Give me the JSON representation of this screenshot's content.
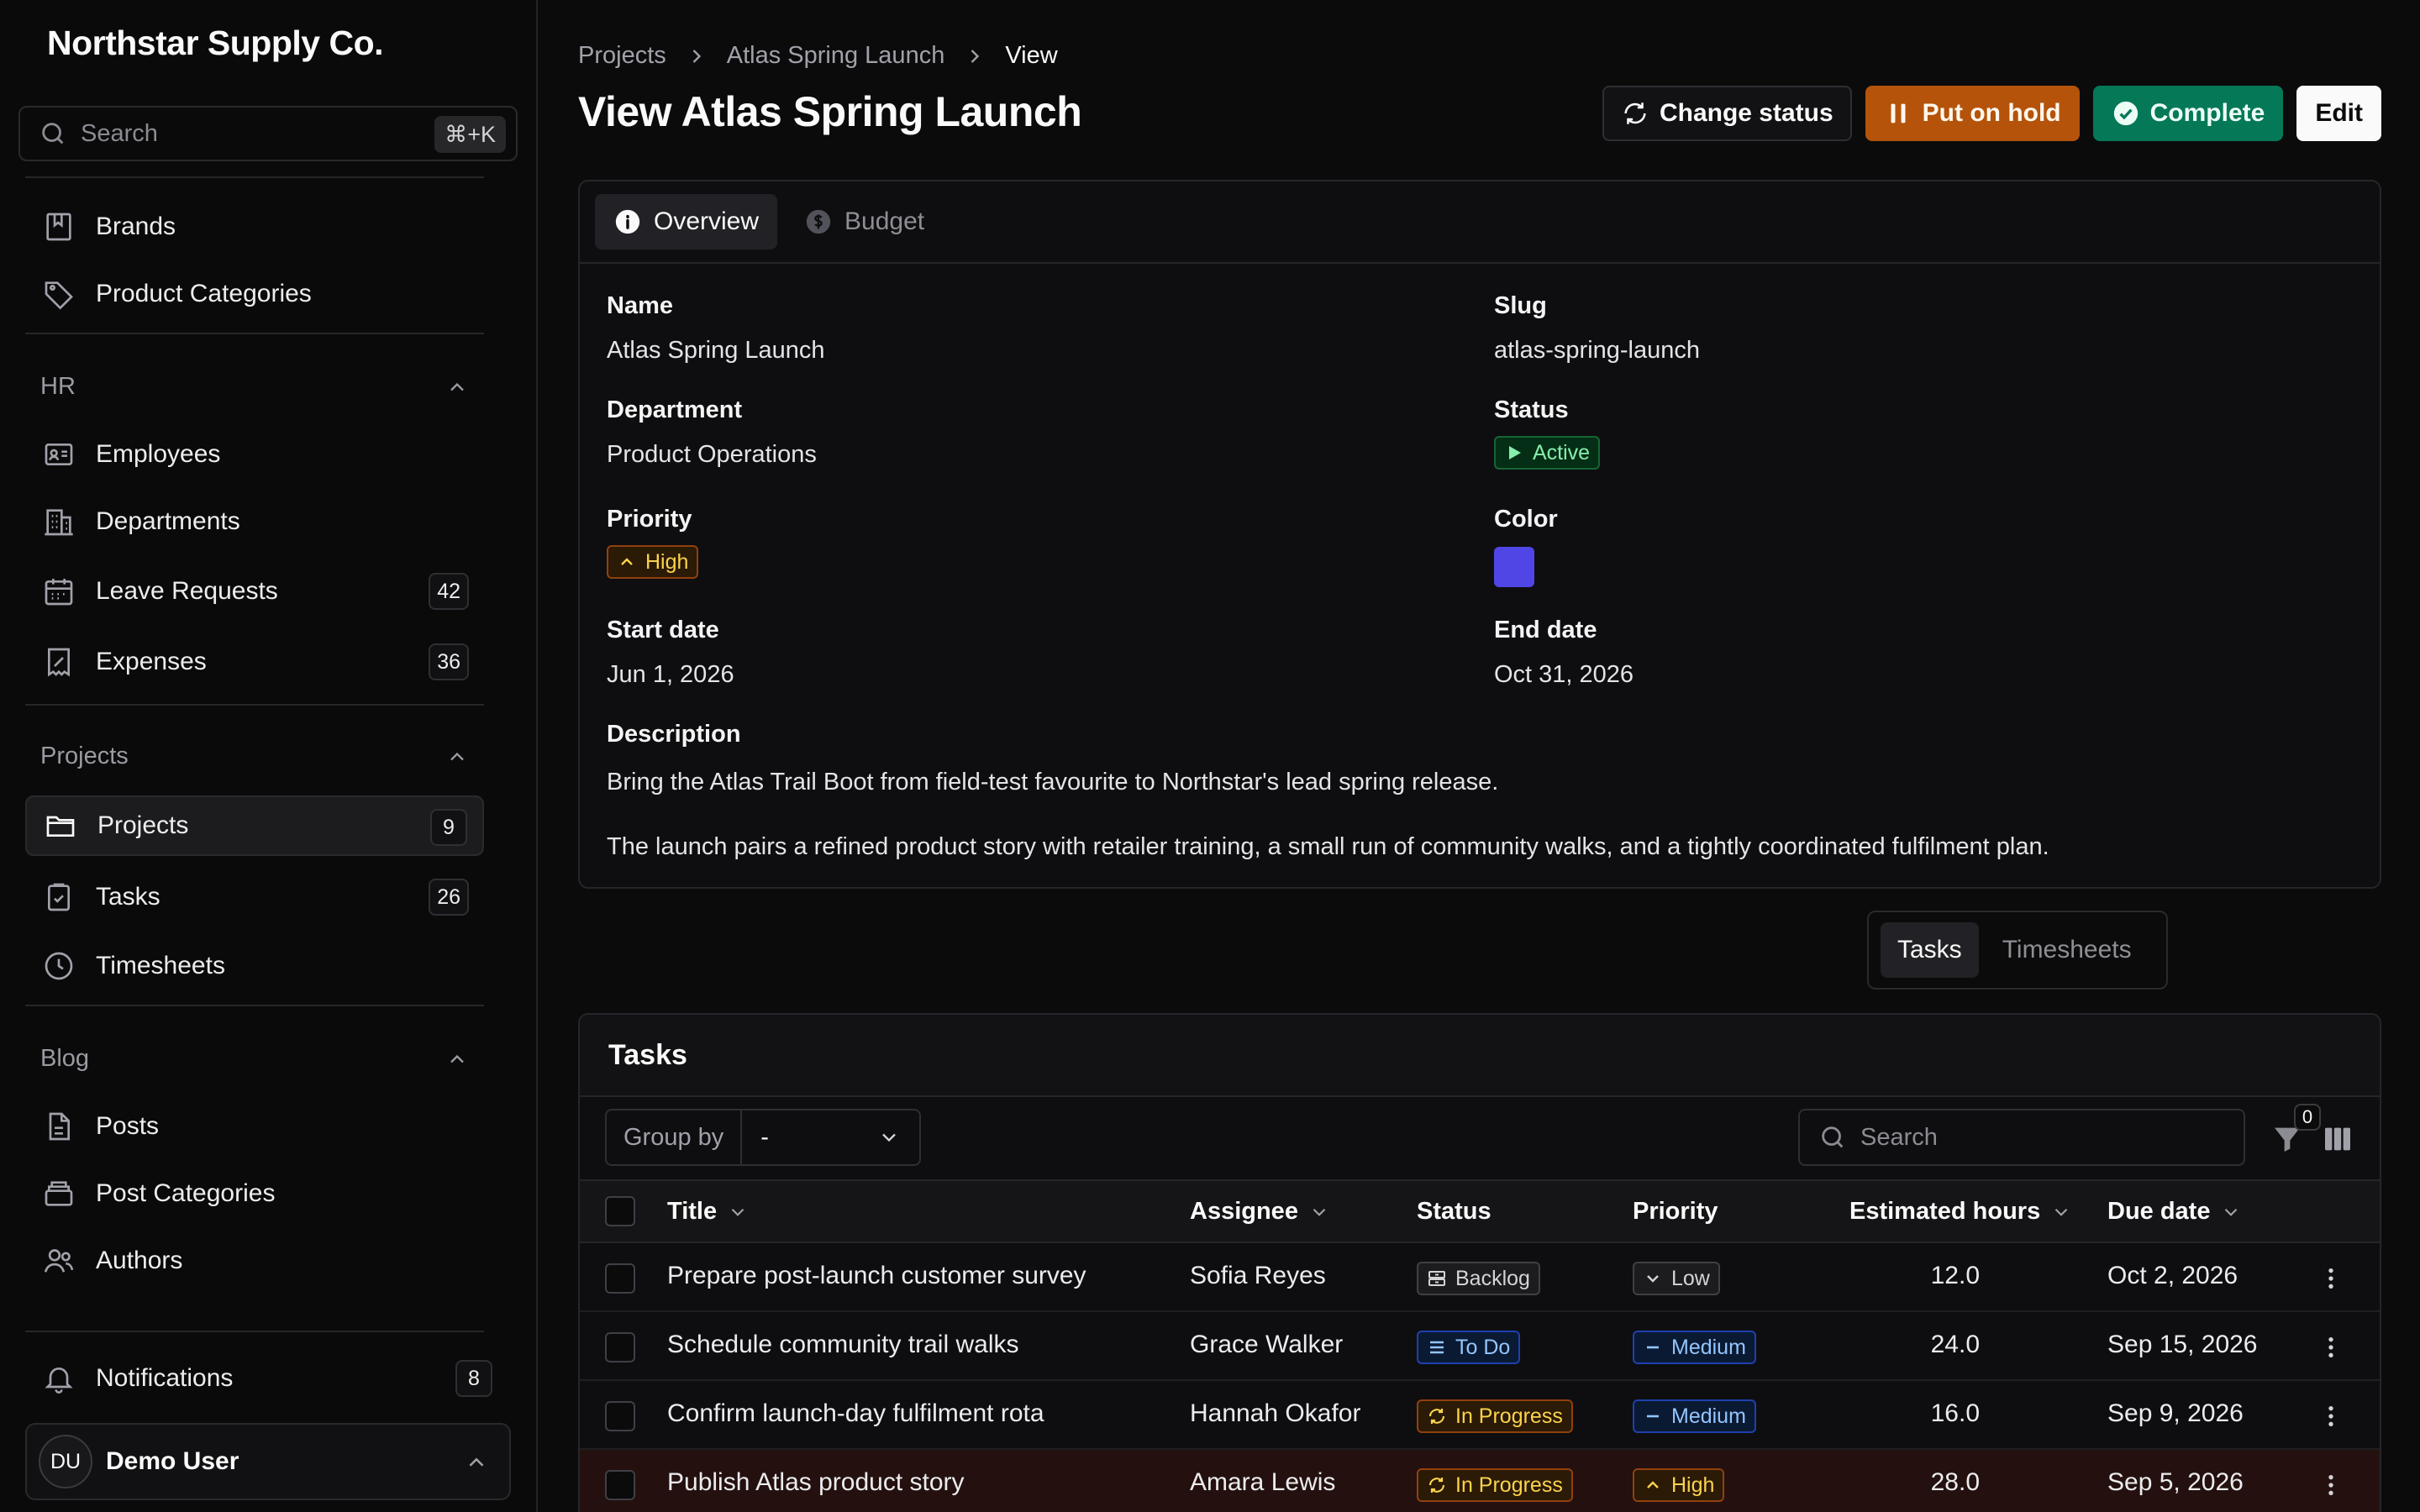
{
  "sidebar": {
    "brand": "Northstar Supply Co.",
    "search_placeholder": "Search",
    "search_shortcut": "⌘+K",
    "items_top": [
      {
        "label": "Brands"
      },
      {
        "label": "Product Categories"
      }
    ],
    "groups": {
      "hr": {
        "label": "HR",
        "items": [
          {
            "label": "Employees"
          },
          {
            "label": "Departments"
          },
          {
            "label": "Leave Requests",
            "count": "42"
          },
          {
            "label": "Expenses",
            "count": "36"
          }
        ]
      },
      "projects": {
        "label": "Projects",
        "items": [
          {
            "label": "Projects",
            "count": "9"
          },
          {
            "label": "Tasks",
            "count": "26"
          },
          {
            "label": "Timesheets"
          }
        ]
      },
      "blog": {
        "label": "Blog",
        "items": [
          {
            "label": "Posts"
          },
          {
            "label": "Post Categories"
          },
          {
            "label": "Authors"
          }
        ]
      }
    },
    "notifications": {
      "label": "Notifications",
      "count": "8"
    },
    "user": {
      "initials": "DU",
      "name": "Demo User"
    }
  },
  "header": {
    "breadcrumbs": [
      "Projects",
      "Atlas Spring Launch",
      "View"
    ],
    "title": "View Atlas Spring Launch",
    "actions": {
      "change_status": "Change status",
      "hold": "Put on hold",
      "complete": "Complete",
      "edit": "Edit"
    }
  },
  "details": {
    "tabs": [
      "Overview",
      "Budget"
    ],
    "name": {
      "label": "Name",
      "value": "Atlas Spring Launch"
    },
    "slug": {
      "label": "Slug",
      "value": "atlas-spring-launch"
    },
    "department": {
      "label": "Department",
      "value": "Product Operations"
    },
    "status": {
      "label": "Status",
      "value": "Active"
    },
    "priority": {
      "label": "Priority",
      "value": "High"
    },
    "color": {
      "label": "Color",
      "hex": "#5046e5"
    },
    "start_date": {
      "label": "Start date",
      "value": "Jun 1, 2026"
    },
    "end_date": {
      "label": "End date",
      "value": "Oct 31, 2026"
    },
    "description": {
      "label": "Description",
      "p1": "Bring the Atlas Trail Boot from field-test favourite to Northstar's lead spring release.",
      "p2": "The launch pairs a refined product story with retailer training, a small run of community walks, and a tightly coordinated fulfilment plan."
    }
  },
  "relation_tabs": [
    "Tasks",
    "Timesheets"
  ],
  "tasks": {
    "heading": "Tasks",
    "group_by_label": "Group by",
    "group_by_value": "-",
    "search_placeholder": "Search",
    "filter_count": "0",
    "columns": [
      "Title",
      "Assignee",
      "Status",
      "Priority",
      "Estimated hours",
      "Due date"
    ],
    "rows": [
      {
        "title": "Prepare post-launch customer survey",
        "assignee": "Sofia Reyes",
        "status": "Backlog",
        "priority": "Low",
        "hours": "12.0",
        "due": "Oct 2, 2026"
      },
      {
        "title": "Schedule community trail walks",
        "assignee": "Grace Walker",
        "status": "To Do",
        "priority": "Medium",
        "hours": "24.0",
        "due": "Sep 15, 2026"
      },
      {
        "title": "Confirm launch-day fulfilment rota",
        "assignee": "Hannah Okafor",
        "status": "In Progress",
        "priority": "Medium",
        "hours": "16.0",
        "due": "Sep 9, 2026"
      },
      {
        "title": "Publish Atlas product story",
        "assignee": "Amara Lewis",
        "status": "In Progress",
        "priority": "High",
        "hours": "28.0",
        "due": "Sep 5, 2026"
      }
    ]
  },
  "colors": {
    "accent_amber": "#b45309",
    "accent_green": "#047857",
    "background": "#0b0b0c"
  }
}
